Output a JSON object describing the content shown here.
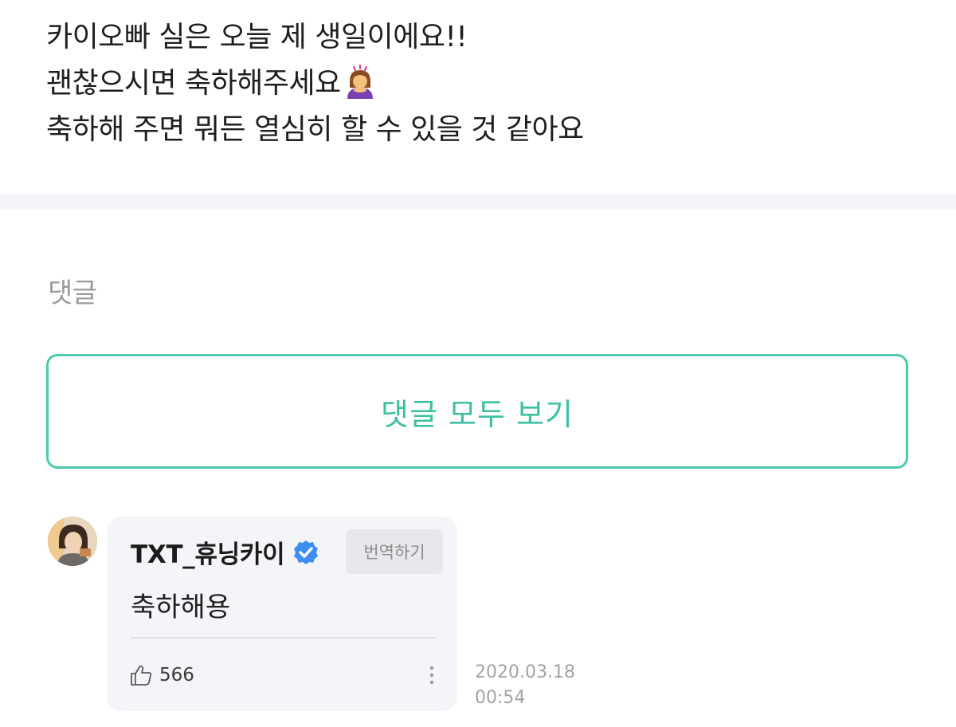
{
  "post": {
    "lines": [
      "카이오빠 실은 오늘 제 생일이에요!!",
      "괜찮으시면 축하해주세요",
      "축하해 주면 뭐든 열심히 할 수 있을 것 같아요"
    ],
    "emoji": "girl-bowing-emoji"
  },
  "comments_section": {
    "label": "댓글",
    "view_all_label": "댓글 모두 보기",
    "accent_color": "#4cc9ae"
  },
  "comment": {
    "author": "TXT_휴닝카이",
    "verified_icon": "verified-check-icon",
    "translate_label": "번역하기",
    "text": "축하해용",
    "like_icon": "thumbs-up-icon",
    "likes": "566",
    "more_icon": "vertical-dots-icon",
    "date": "2020.03.18",
    "time": "00:54"
  }
}
